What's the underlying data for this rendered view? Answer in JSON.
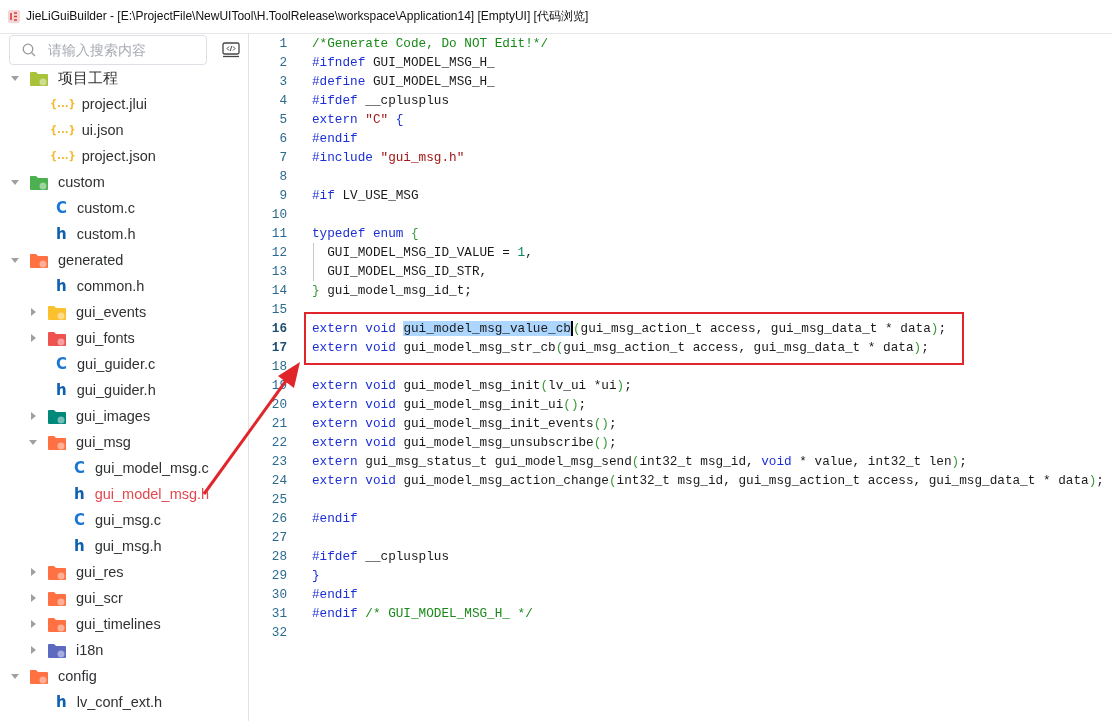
{
  "window": {
    "title": "JieLiGuiBuilder - [E:\\ProjectFile\\NewUITool\\H.ToolRelease\\workspace\\Application14] [EmptyUI] [代码浏览]"
  },
  "sidebar": {
    "search": {
      "placeholder": "请输入搜索内容"
    },
    "tree": [
      {
        "label": "项目工程",
        "kind": "folder",
        "color": "#a8c23a",
        "expanded": true,
        "selected": false,
        "children": [
          {
            "label": "project.jlui",
            "kind": "json",
            "glyph": "{...}",
            "selected": false
          },
          {
            "label": "ui.json",
            "kind": "json",
            "glyph": "{...}",
            "selected": false
          },
          {
            "label": "project.json",
            "kind": "json",
            "glyph": "{...}",
            "selected": false
          }
        ]
      },
      {
        "label": "custom",
        "kind": "folder",
        "color": "#4caf50",
        "expanded": true,
        "selected": false,
        "children": [
          {
            "label": "custom.c",
            "kind": "source",
            "glyph": "C",
            "selected": false
          },
          {
            "label": "custom.h",
            "kind": "header",
            "glyph": "h",
            "selected": false
          }
        ]
      },
      {
        "label": "generated",
        "kind": "folder",
        "color": "#ff7043",
        "expanded": true,
        "selected": false,
        "children": [
          {
            "label": "common.h",
            "kind": "header",
            "glyph": "h",
            "selected": false
          },
          {
            "label": "gui_events",
            "kind": "folder",
            "color": "#fbc02d",
            "expanded": false,
            "selected": false
          },
          {
            "label": "gui_fonts",
            "kind": "folder",
            "color": "#ef5350",
            "expanded": false,
            "selected": false
          },
          {
            "label": "gui_guider.c",
            "kind": "source",
            "glyph": "C",
            "selected": false
          },
          {
            "label": "gui_guider.h",
            "kind": "header",
            "glyph": "h",
            "selected": false
          },
          {
            "label": "gui_images",
            "kind": "folder",
            "color": "#00897b",
            "expanded": false,
            "selected": false
          },
          {
            "label": "gui_msg",
            "kind": "folder",
            "color": "#ff7043",
            "expanded": true,
            "selected": false,
            "children": [
              {
                "label": "gui_model_msg.c",
                "kind": "source",
                "glyph": "C",
                "selected": false
              },
              {
                "label": "gui_model_msg.h",
                "kind": "header",
                "glyph": "h",
                "selected": true
              },
              {
                "label": "gui_msg.c",
                "kind": "source",
                "glyph": "C",
                "selected": false
              },
              {
                "label": "gui_msg.h",
                "kind": "header",
                "glyph": "h",
                "selected": false
              }
            ]
          },
          {
            "label": "gui_res",
            "kind": "folder",
            "color": "#ff7043",
            "expanded": false,
            "selected": false
          },
          {
            "label": "gui_scr",
            "kind": "folder",
            "color": "#ff7043",
            "expanded": false,
            "selected": false
          },
          {
            "label": "gui_timelines",
            "kind": "folder",
            "color": "#ff7043",
            "expanded": false,
            "selected": false
          },
          {
            "label": "i18n",
            "kind": "folder",
            "color": "#5c6bc0",
            "expanded": false,
            "selected": false
          }
        ]
      },
      {
        "label": "config",
        "kind": "folder",
        "color": "#ff7043",
        "expanded": true,
        "selected": false,
        "children": [
          {
            "label": "lv_conf_ext.h",
            "kind": "header",
            "glyph": "h",
            "selected": false
          }
        ]
      }
    ]
  },
  "editor": {
    "lines": [
      {
        "number": "1",
        "tokens": [
          {
            "kind": "comment",
            "text": "/*Generate Code, Do NOT Edit!*/"
          }
        ]
      },
      {
        "number": "2",
        "tokens": [
          {
            "kind": "keyword",
            "text": "#ifndef"
          },
          {
            "kind": "plain",
            "text": " GUI_MODEL_MSG_H_"
          }
        ]
      },
      {
        "number": "3",
        "tokens": [
          {
            "kind": "keyword",
            "text": "#define"
          },
          {
            "kind": "plain",
            "text": " GUI_MODEL_MSG_H_"
          }
        ]
      },
      {
        "number": "4",
        "tokens": [
          {
            "kind": "keyword",
            "text": "#ifdef"
          },
          {
            "kind": "plain",
            "text": " __cplusplus"
          }
        ]
      },
      {
        "number": "5",
        "tokens": [
          {
            "kind": "keyword",
            "text": "extern "
          },
          {
            "kind": "string",
            "text": "\"C\""
          },
          {
            "kind": "keyword",
            "text": " {"
          }
        ]
      },
      {
        "number": "6",
        "tokens": [
          {
            "kind": "keyword",
            "text": "#endif"
          }
        ]
      },
      {
        "number": "7",
        "tokens": [
          {
            "kind": "keyword",
            "text": "#include "
          },
          {
            "kind": "string",
            "text": "\"gui_msg.h\""
          }
        ]
      },
      {
        "number": "8"
      },
      {
        "number": "9",
        "tokens": [
          {
            "kind": "keyword",
            "text": "#if"
          },
          {
            "kind": "plain",
            "text": " LV_USE_MSG"
          }
        ]
      },
      {
        "number": "10"
      },
      {
        "number": "11",
        "tokens": [
          {
            "kind": "keyword",
            "text": "typedef enum "
          },
          {
            "kind": "bracket",
            "text": "{"
          }
        ]
      },
      {
        "number": "12",
        "indent_guide": true,
        "tokens": [
          {
            "kind": "plain",
            "text": "  GUI_MODEL_MSG_ID_VALUE = "
          },
          {
            "kind": "number",
            "text": "1"
          },
          {
            "kind": "plain",
            "text": ","
          }
        ]
      },
      {
        "number": "13",
        "indent_guide": true,
        "tokens": [
          {
            "kind": "plain",
            "text": "  GUI_MODEL_MSG_ID_STR,"
          }
        ]
      },
      {
        "number": "14",
        "tokens": [
          {
            "kind": "bracket",
            "text": "}"
          },
          {
            "kind": "plain",
            "text": " gui_model_msg_id_t;"
          }
        ]
      },
      {
        "number": "15"
      },
      {
        "number": "16",
        "boxed": true,
        "tokens": [
          {
            "kind": "keyword",
            "text": "extern void "
          },
          {
            "kind": "selection",
            "text": "gui_model_msg_value_cb"
          },
          {
            "kind": "bracket",
            "text": "("
          },
          {
            "kind": "plain",
            "text": "gui_msg_action_t access, gui_msg_data_t * data"
          },
          {
            "kind": "bracket",
            "text": ")"
          },
          {
            "kind": "plain",
            "text": ";"
          }
        ]
      },
      {
        "number": "17",
        "boxed": true,
        "tokens": [
          {
            "kind": "keyword",
            "text": "extern void "
          },
          {
            "kind": "plain",
            "text": "gui_model_msg_str_cb"
          },
          {
            "kind": "bracket",
            "text": "("
          },
          {
            "kind": "plain",
            "text": "gui_msg_action_t access, gui_msg_data_t * data"
          },
          {
            "kind": "bracket",
            "text": ")"
          },
          {
            "kind": "plain",
            "text": ";"
          }
        ]
      },
      {
        "number": "18"
      },
      {
        "number": "19",
        "tokens": [
          {
            "kind": "keyword",
            "text": "extern void "
          },
          {
            "kind": "plain",
            "text": "gui_model_msg_init"
          },
          {
            "kind": "bracket",
            "text": "("
          },
          {
            "kind": "plain",
            "text": "lv_ui *ui"
          },
          {
            "kind": "bracket",
            "text": ")"
          },
          {
            "kind": "plain",
            "text": ";"
          }
        ]
      },
      {
        "number": "20",
        "tokens": [
          {
            "kind": "keyword",
            "text": "extern void "
          },
          {
            "kind": "plain",
            "text": "gui_model_msg_init_ui"
          },
          {
            "kind": "bracket",
            "text": "()"
          },
          {
            "kind": "plain",
            "text": ";"
          }
        ]
      },
      {
        "number": "21",
        "tokens": [
          {
            "kind": "keyword",
            "text": "extern void "
          },
          {
            "kind": "plain",
            "text": "gui_model_msg_init_events"
          },
          {
            "kind": "bracket",
            "text": "()"
          },
          {
            "kind": "plain",
            "text": ";"
          }
        ]
      },
      {
        "number": "22",
        "tokens": [
          {
            "kind": "keyword",
            "text": "extern void "
          },
          {
            "kind": "plain",
            "text": "gui_model_msg_unsubscribe"
          },
          {
            "kind": "bracket",
            "text": "()"
          },
          {
            "kind": "plain",
            "text": ";"
          }
        ]
      },
      {
        "number": "23",
        "tokens": [
          {
            "kind": "keyword",
            "text": "extern "
          },
          {
            "kind": "plain",
            "text": "gui_msg_status_t gui_model_msg_send"
          },
          {
            "kind": "bracket",
            "text": "("
          },
          {
            "kind": "plain",
            "text": "int32_t msg_id, "
          },
          {
            "kind": "keyword",
            "text": "void"
          },
          {
            "kind": "plain",
            "text": " * value, int32_t len"
          },
          {
            "kind": "bracket",
            "text": ")"
          },
          {
            "kind": "plain",
            "text": ";"
          }
        ]
      },
      {
        "number": "24",
        "tokens": [
          {
            "kind": "keyword",
            "text": "extern void "
          },
          {
            "kind": "plain",
            "text": "gui_model_msg_action_change"
          },
          {
            "kind": "bracket",
            "text": "("
          },
          {
            "kind": "plain",
            "text": "int32_t msg_id, gui_msg_action_t access, gui_msg_data_t * data"
          },
          {
            "kind": "bracket",
            "text": ")"
          },
          {
            "kind": "plain",
            "text": ";"
          }
        ]
      },
      {
        "number": "25"
      },
      {
        "number": "26",
        "tokens": [
          {
            "kind": "keyword",
            "text": "#endif"
          }
        ]
      },
      {
        "number": "27"
      },
      {
        "number": "28",
        "tokens": [
          {
            "kind": "keyword",
            "text": "#ifdef"
          },
          {
            "kind": "plain",
            "text": " __cplusplus"
          }
        ]
      },
      {
        "number": "29",
        "tokens": [
          {
            "kind": "keyword",
            "text": "}"
          }
        ]
      },
      {
        "number": "30",
        "tokens": [
          {
            "kind": "keyword",
            "text": "#endif"
          }
        ]
      },
      {
        "number": "31",
        "tokens": [
          {
            "kind": "keyword",
            "text": "#endif"
          },
          {
            "kind": "comment",
            "text": " /* GUI_MODEL_MSG_H_ */"
          }
        ]
      },
      {
        "number": "32"
      }
    ]
  }
}
